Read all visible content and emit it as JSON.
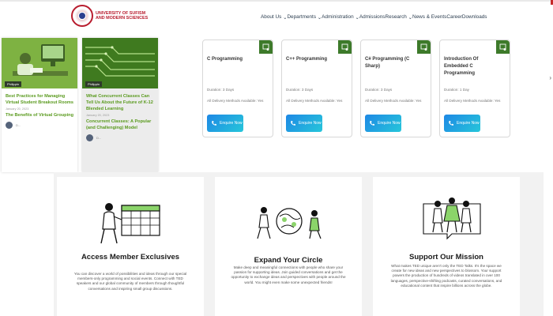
{
  "header": {
    "logo_line1": "UNIVERSITY OF SUFISM",
    "logo_line2": "AND MODERN SCIENCES",
    "nav": [
      "About Us",
      "Departments",
      "Administration",
      "Admissions",
      "Research",
      "News & Events",
      "Career",
      "Downloads"
    ],
    "nav_separator": " ⌄",
    "chevron": "›"
  },
  "blog_cards": [
    {
      "tag": "Philippin",
      "title": "Best Practices for Managing Virtual Student Breakout Rooms",
      "date": "January 20, 2023",
      "subtitle": "The Benefits of Virtual Grouping",
      "author": "D..."
    },
    {
      "tag": "Philippin",
      "title": "What Concurrent Classes Can Tell Us About the Future of K-12 Blended Learning",
      "date": "January 20, 2023",
      "subtitle": "Concurrent Classes: A Popular (and Challenging) Model",
      "author": "D..."
    }
  ],
  "courses": [
    {
      "title": "C Programming",
      "duration": "Duration: 3 Days",
      "delivery": "All Delivery Methods Available: Yes",
      "button": "Enquire Now"
    },
    {
      "title": "C++ Programming",
      "duration": "Duration: 3 Days",
      "delivery": "All Delivery Methods Available: Yes",
      "button": "Enquire Now"
    },
    {
      "title": "C# Programming (C Sharp)",
      "duration": "Duration: 3 Days",
      "delivery": "All Delivery Methods Available: Yes",
      "button": "Enquire Now"
    },
    {
      "title": "Introduction Of Embedded C Programming",
      "duration": "Duration: 1 Day",
      "delivery": "All Delivery Methods Available: Yes",
      "button": "Enquire Now"
    }
  ],
  "features": [
    {
      "title": "Access Member Exclusives",
      "body": "You can discover a world of possibilities and ideas through our special members-only programming and social events. Connect with TED speakers and our global community of members through thoughtful conversations and inspiring small group discussions."
    },
    {
      "title": "Expand Your Circle",
      "body": "Make deep and meaningful connections with people who share your passion for supporting ideas. Join guided conversations and get the opportunity to exchange ideas and perspectives with people around the world. You might even make some unexpected friends!"
    },
    {
      "title": "Support Our Mission",
      "body": "What makes TED unique aren't only the TED Talks. It's the space we create for new ideas and new perspectives to blossom. Your support powers the production of hundreds of videos translated in over 100 languages, perspective-shifting podcasts, curated conversations, and educational content that inspire billions across the globe."
    }
  ],
  "colors": {
    "brand_red": "#b81c2e",
    "green": "#3d7a2a",
    "link_green": "#5a9a1e",
    "button_blue": "#1e88e5"
  }
}
